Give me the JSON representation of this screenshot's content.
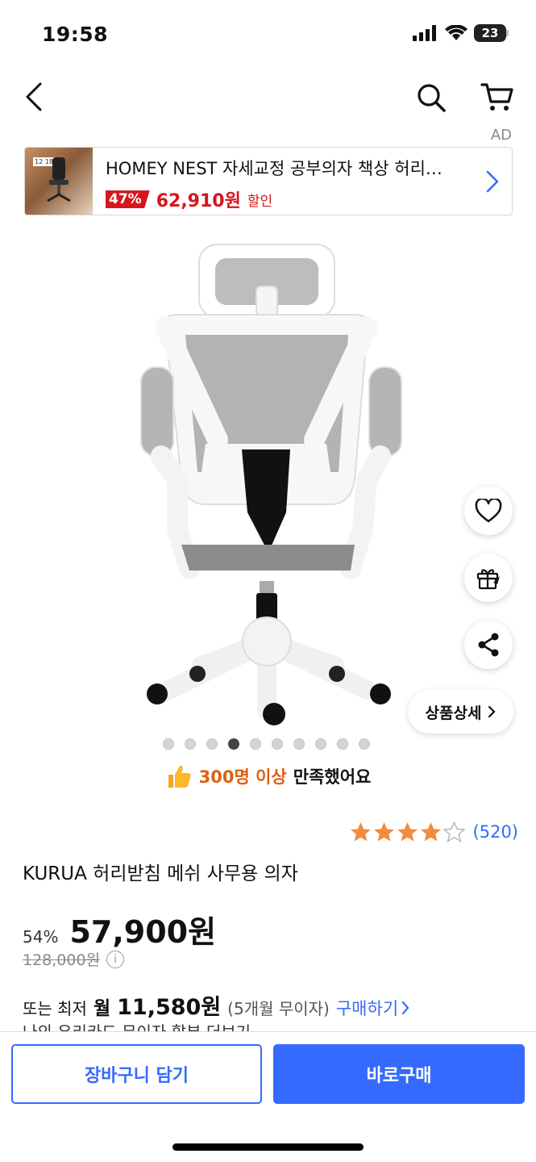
{
  "status": {
    "time": "19:58",
    "battery": "23"
  },
  "nav": {
    "back_icon": "chevron-left-icon",
    "search_icon": "search-icon",
    "cart_icon": "cart-icon"
  },
  "ad": {
    "label": "AD",
    "title": "HOMEY NEST 자세교정 공부의자 책상 허리…",
    "discount": "47%",
    "price": "62,910원",
    "sale_label": "할인",
    "thumb_text": "12 18"
  },
  "gallery": {
    "total_dots": 10,
    "active_index": 3
  },
  "actions": {
    "detail_label": "상품상세"
  },
  "satisfaction": {
    "highlight": "300명 이상",
    "text": "만족했어요"
  },
  "rating": {
    "stars": 4,
    "max_stars": 5,
    "count": "(520)"
  },
  "product": {
    "title": "KURUA 허리받침 메쉬 사무용 의자",
    "discount_pct": "54%",
    "price": "57,900원",
    "original_price": "128,000원",
    "info_icon": "i"
  },
  "installment": {
    "prefix": "또는 최저",
    "month": "월",
    "amount": "11,580원",
    "note": "(5개월 무이자)",
    "link": "구매하기"
  },
  "partial_line": "나의 우리카드 무이자 할부 더보기",
  "bottom": {
    "cart_button": "장바구니 담기",
    "buy_button": "바로구매"
  },
  "colors": {
    "accent": "#346aff",
    "sale_red": "#d7151d",
    "star": "#f28b3c",
    "highlight_orange": "#e05f10"
  }
}
